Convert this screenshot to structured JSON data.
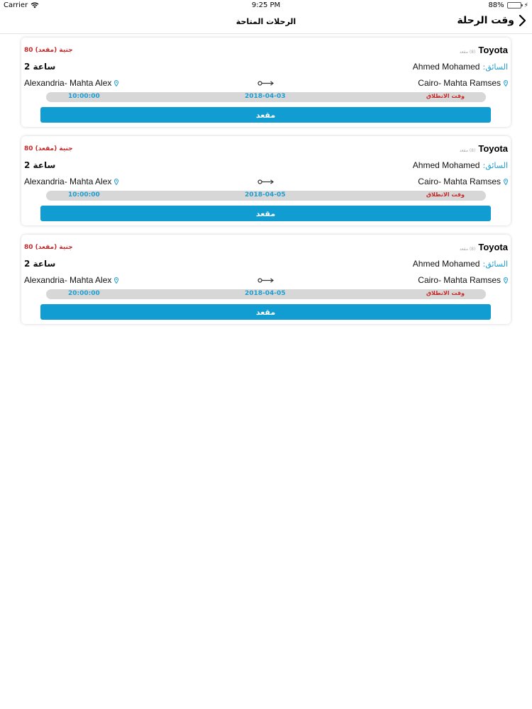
{
  "status_bar": {
    "carrier": "Carrier",
    "time": "9:25 PM",
    "battery_text": "88%",
    "battery_level": 0.88
  },
  "nav": {
    "title": "الرحلات المتاحة",
    "back_label": "وقت الرحلة"
  },
  "colors": {
    "accent": "#119dd2",
    "price": "#c62828",
    "bar": "#d7d7d7"
  },
  "trips": [
    {
      "car": "Toyota",
      "seats_note": "(8) مقعد",
      "price": "80 جنية (مقعد)",
      "driver_label": "السائق:",
      "driver_name": "Ahmed Mohamed",
      "duration": "2 ساعة",
      "from": "Cairo- Mahta Ramses",
      "to": "Alexandria- Mahta Alex",
      "departure_label": "وقت الانطلاق",
      "date": "2018-04-03",
      "time": "10:00:00",
      "button": "مقعد"
    },
    {
      "car": "Toyota",
      "seats_note": "(8) مقعد",
      "price": "80 جنية (مقعد)",
      "driver_label": "السائق:",
      "driver_name": "Ahmed Mohamed",
      "duration": "2 ساعة",
      "from": "Cairo- Mahta Ramses",
      "to": "Alexandria- Mahta Alex",
      "departure_label": "وقت الانطلاق",
      "date": "2018-04-05",
      "time": "10:00:00",
      "button": "مقعد"
    },
    {
      "car": "Toyota",
      "seats_note": "(8) مقعد",
      "price": "80 جنية (مقعد)",
      "driver_label": "السائق:",
      "driver_name": "Ahmed Mohamed",
      "duration": "2 ساعة",
      "from": "Cairo- Mahta Ramses",
      "to": "Alexandria- Mahta Alex",
      "departure_label": "وقت الانطلاق",
      "date": "2018-04-05",
      "time": "20:00:00",
      "button": "مقعد"
    }
  ]
}
